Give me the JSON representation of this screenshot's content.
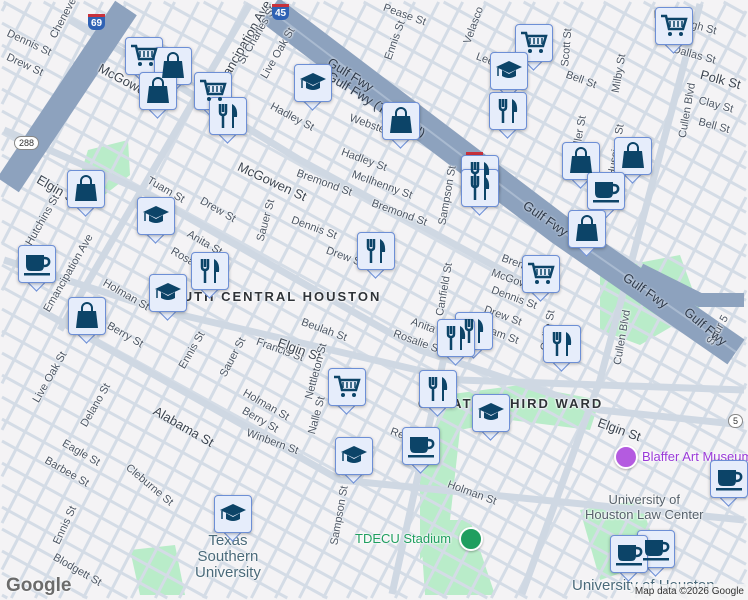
{
  "map": {
    "attribution": "Map data ©2026 Google",
    "logo": "Google",
    "colors": {
      "background": "#f4f3f5",
      "street": "#d4dce6",
      "freeway": "#8da2be",
      "park": "#b9ecc9",
      "marker_fill": "#e6edfb",
      "marker_border": "#6d8fd6",
      "icon": "#0c4468"
    },
    "shields": [
      "69",
      "45",
      "288",
      "45",
      "5",
      "5"
    ],
    "labels": [
      "Dennis St",
      "Drew St",
      "Chenevert",
      "McGowen St",
      "Emancipation Ave",
      "St Charles St",
      "Live Oak St",
      "Hadley St",
      "Webster St",
      "Hadley St",
      "McIlhenny St",
      "Bremond St",
      "McGowen St",
      "Tuam St",
      "Drew St",
      "Sauer St",
      "Dennis St",
      "Anita St",
      "Rosalie St",
      "Drew St",
      "Elgin St",
      "Hutchins St",
      "Emancipation Ave",
      "Holman St",
      "Berry St",
      "Live Oak St",
      "Delano St",
      "Ennis St",
      "Sauer St",
      "Francis St",
      "Beulah St",
      "Elgin St",
      "Nettleton St",
      "Holman St",
      "Berry St",
      "Winbern St",
      "Alabama St",
      "Nalle St",
      "Eagle St",
      "Barbee St",
      "Cleburne St",
      "Ennis St",
      "Blodgett St",
      "Sampson St",
      "Gulf Fwy (Toll road)",
      "Gulf Fwy",
      "Ennis St",
      "Pease St",
      "Velasco",
      "Leeland",
      "Scott St",
      "Bell St",
      "Milby St",
      "Woodleigh St",
      "Dallas St",
      "Polk St",
      "Clay St",
      "Bell St",
      "Cullen Blvd",
      "Miller St",
      "Hussion St",
      "Sampson St",
      "Bremond St",
      "Gulf Fwy",
      "Gulf Fwy",
      "Bremond St",
      "McGowen",
      "Dennis St",
      "Canfield St",
      "Drew St",
      "Tuam St",
      "Anita St",
      "Rosalie St",
      "Callie St",
      "Cullen Blvd",
      "Spur 5",
      "Gulf Fwy",
      "Elgin St",
      "Reeves St",
      "Holman St",
      "SOUTH CENTRAL HOUSTON",
      "GREATER THIRD WARD",
      "Texas\nSouthern\nUniversity",
      "Blaffer Art Museum",
      "University of\nHouston Law Center",
      "TDECU Stadium",
      "University of Houston"
    ],
    "markers": [
      {
        "type": "shopping-cart"
      },
      {
        "type": "shopping-bag"
      },
      {
        "type": "shopping-bag"
      },
      {
        "type": "shopping-cart"
      },
      {
        "type": "restaurant"
      },
      {
        "type": "school"
      },
      {
        "type": "shopping-bag"
      },
      {
        "type": "shopping-cart"
      },
      {
        "type": "school"
      },
      {
        "type": "restaurant"
      },
      {
        "type": "shopping-cart"
      },
      {
        "type": "shopping-bag"
      },
      {
        "type": "school"
      },
      {
        "type": "cafe"
      },
      {
        "type": "restaurant"
      },
      {
        "type": "school"
      },
      {
        "type": "shopping-bag"
      },
      {
        "type": "restaurant"
      },
      {
        "type": "restaurant"
      },
      {
        "type": "shopping-bag"
      },
      {
        "type": "shopping-bag"
      },
      {
        "type": "cafe"
      },
      {
        "type": "shopping-bag"
      },
      {
        "type": "restaurant"
      },
      {
        "type": "shopping-cart"
      },
      {
        "type": "restaurant"
      },
      {
        "type": "restaurant"
      },
      {
        "type": "restaurant"
      },
      {
        "type": "restaurant"
      },
      {
        "type": "shopping-cart"
      },
      {
        "type": "school"
      },
      {
        "type": "cafe"
      },
      {
        "type": "school"
      },
      {
        "type": "school"
      },
      {
        "type": "cafe"
      },
      {
        "type": "cafe"
      },
      {
        "type": "cafe"
      }
    ]
  }
}
